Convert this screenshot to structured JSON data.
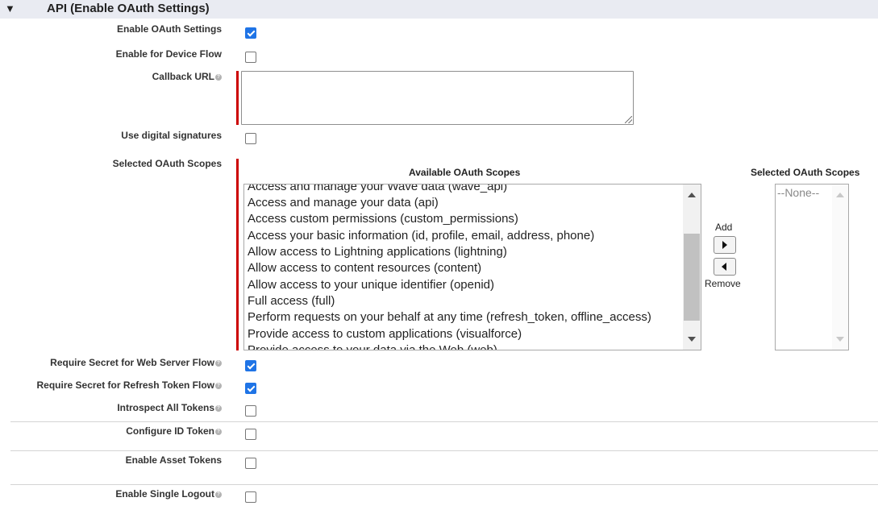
{
  "section": {
    "title": "API (Enable OAuth Settings)",
    "collapse_icon": "triangle-down-icon"
  },
  "fields": {
    "enable_oauth": {
      "label": "Enable OAuth Settings",
      "checked": true
    },
    "device_flow": {
      "label": "Enable for Device Flow",
      "checked": false
    },
    "callback_url": {
      "label": "Callback URL",
      "value": ""
    },
    "digital_signatures": {
      "label": "Use digital signatures",
      "checked": false
    },
    "oauth_scopes": {
      "label": "Selected OAuth Scopes"
    },
    "secret_web_server": {
      "label": "Require Secret for Web Server Flow",
      "checked": true
    },
    "secret_refresh": {
      "label": "Require Secret for Refresh Token Flow",
      "checked": true
    },
    "introspect": {
      "label": "Introspect All Tokens",
      "checked": false
    },
    "id_token": {
      "label": "Configure ID Token",
      "checked": false
    },
    "asset_tokens": {
      "label": "Enable Asset Tokens",
      "checked": false
    },
    "single_logout": {
      "label": "Enable Single Logout",
      "checked": false
    }
  },
  "scopes": {
    "available_label": "Available OAuth Scopes",
    "selected_label": "Selected OAuth Scopes",
    "available": [
      "Access and manage your Wave data (wave_api)",
      "Access and manage your data (api)",
      "Access custom permissions (custom_permissions)",
      "Access your basic information (id, profile, email, address, phone)",
      "Allow access to Lightning applications (lightning)",
      "Allow access to content resources (content)",
      "Allow access to your unique identifier (openid)",
      "Full access (full)",
      "Perform requests on your behalf at any time (refresh_token, offline_access)",
      "Provide access to custom applications (visualforce)",
      "Provide access to your data via the Web (web)"
    ],
    "selected": [
      "--None--"
    ],
    "add_label": "Add",
    "remove_label": "Remove"
  },
  "colors": {
    "accent": "#1f74e6",
    "required": "#cc0000",
    "header_bg": "#e9ebf2"
  }
}
